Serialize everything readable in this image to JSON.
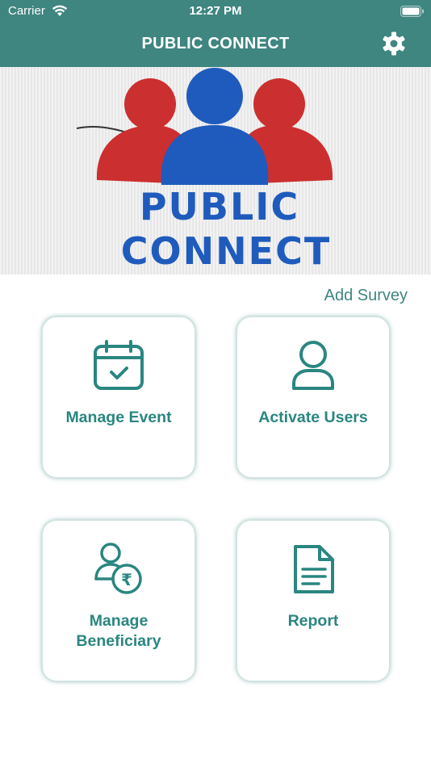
{
  "status_bar": {
    "carrier": "Carrier",
    "time": "12:27 PM"
  },
  "nav": {
    "title": "PUBLIC CONNECT",
    "settings_icon": "gear-icon"
  },
  "banner": {
    "logo_text_line1": "PUBLIC",
    "logo_text_line2": "CONNECT"
  },
  "add_survey_label": "Add Survey",
  "cards": [
    {
      "label_line1": "Manage Event",
      "label_line2": "",
      "icon": "calendar-check-icon"
    },
    {
      "label_line1": "Activate Users",
      "label_line2": "",
      "icon": "user-icon"
    },
    {
      "label_line1": "Manage",
      "label_line2": "Beneficiary",
      "icon": "user-rupee-icon"
    },
    {
      "label_line1": "Report",
      "label_line2": "",
      "icon": "document-icon"
    }
  ],
  "colors": {
    "header": "#3f8580",
    "accent": "#2a8680",
    "logo_red": "#cc2f2f",
    "logo_blue": "#1f5bbd"
  }
}
